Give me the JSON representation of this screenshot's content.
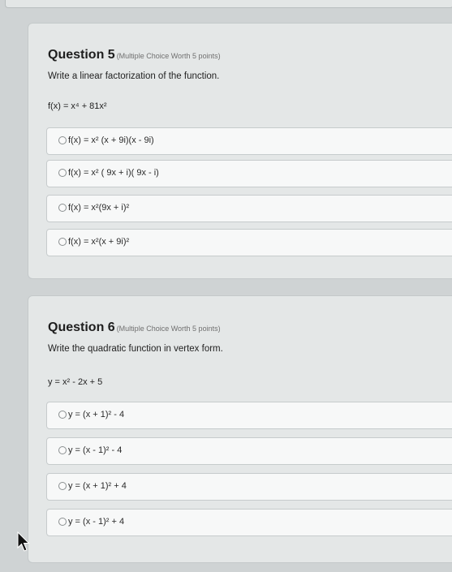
{
  "questions": [
    {
      "title": "Question 5",
      "meta": "(Multiple Choice Worth 5 points)",
      "prompt": "Write a linear factorization of the function.",
      "expression": "f(x) = x⁴ + 81x²",
      "options": [
        "f(x) = x² (x + 9i)(x - 9i)",
        "f(x) = x² ( 9x + i)( 9x - i)",
        "f(x) = x²(9x + i)²",
        "f(x) = x²(x + 9i)²"
      ]
    },
    {
      "title": "Question 6",
      "meta": "(Multiple Choice Worth 5 points)",
      "prompt": "Write the quadratic function in vertex form.",
      "expression": "y = x² - 2x + 5",
      "options": [
        "y = (x + 1)² - 4",
        "y = (x - 1)² - 4",
        "y = (x + 1)² + 4",
        "y = (x - 1)² + 4"
      ]
    }
  ]
}
